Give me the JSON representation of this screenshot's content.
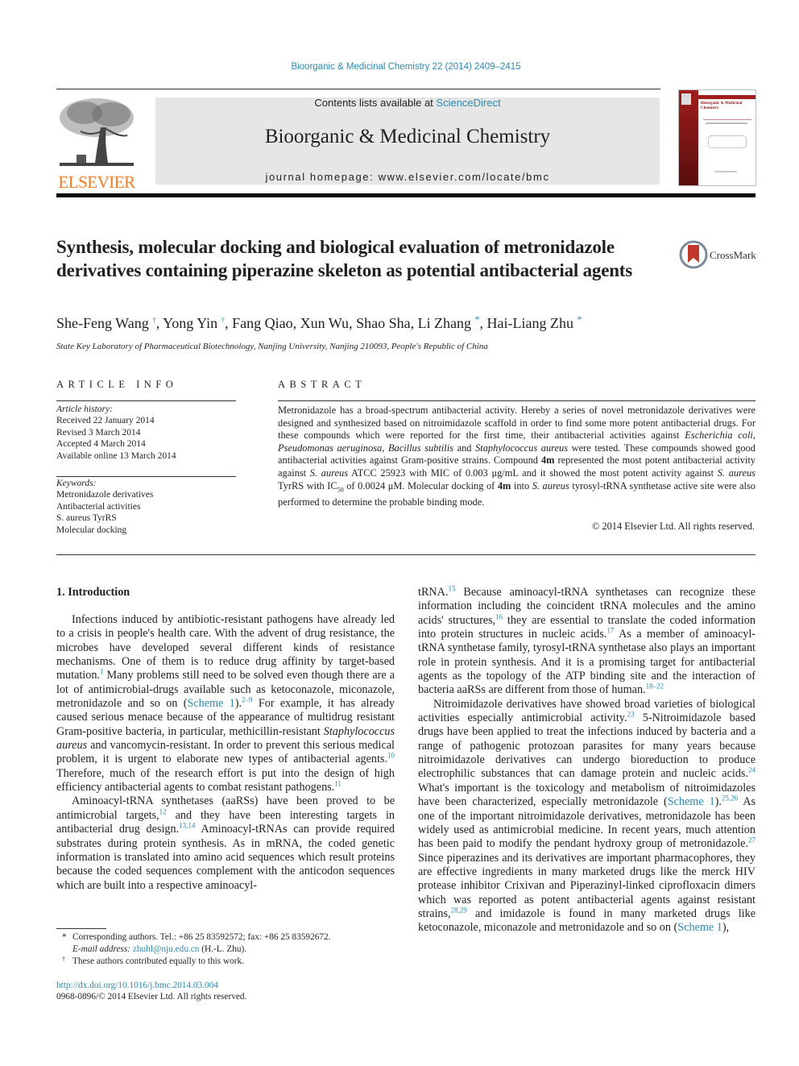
{
  "header": {
    "journal_reference": "Bioorganic & Medicinal Chemistry 22 (2014) 2409–2415",
    "contents_prefix": "Contents lists available at ",
    "contents_link": "ScienceDirect",
    "journal_title": "Bioorganic & Medicinal Chemistry",
    "homepage_label": "journal homepage: ",
    "homepage_url": "www.elsevier.com/locate/bmc",
    "publisher_logo_text": "ELSEVIER",
    "publisher_color": "#f47a20",
    "cover_title_line1": "Bioorganic & Medicinal",
    "cover_title_line2": "Chemistry",
    "cover_color": "#8b1a1a",
    "link_color": "#2a8bb5"
  },
  "article": {
    "title": "Synthesis, molecular docking and biological evaluation of metronidazole derivatives containing piperazine skeleton as potential antibacterial agents",
    "crossmark_label": "CrossMark",
    "authors": [
      {
        "name": "She-Feng Wang",
        "mark": "†"
      },
      {
        "name": "Yong Yin",
        "mark": "†"
      },
      {
        "name": "Fang Qiao",
        "mark": ""
      },
      {
        "name": "Xun Wu",
        "mark": ""
      },
      {
        "name": "Shao Sha",
        "mark": ""
      },
      {
        "name": "Li Zhang",
        "mark": "*"
      },
      {
        "name": "Hai-Liang Zhu",
        "mark": "*"
      }
    ],
    "affiliation": "State Key Laboratory of Pharmaceutical Biotechnology, Nanjing University, Nanjing 210093, People's Republic of China"
  },
  "article_info": {
    "label": "ARTICLE INFO",
    "history_label": "Article history:",
    "history": [
      "Received 22 January 2014",
      "Revised 3 March 2014",
      "Accepted 4 March 2014",
      "Available online 13 March 2014"
    ],
    "keywords_label": "Keywords:",
    "keywords": [
      "Metronidazole derivatives",
      "Antibacterial activities",
      "S. aureus TyrRS",
      "Molecular docking"
    ]
  },
  "abstract": {
    "label": "ABSTRACT",
    "s1": "Metronidazole has a broad-spectrum antibacterial activity. Hereby a series of novel metronidazole derivatives were designed and synthesized based on nitroimidazole scaffold in order to find some more potent antibacterial drugs. For these compounds which were reported for the first time, their antibacterial activities against ",
    "org1": "Escherichia coli",
    "sep1": ", ",
    "org2": "Pseudomonas aeruginosa",
    "sep2": ", ",
    "org3": "Bacillus subtilis",
    "sep3": " and ",
    "org4": "Staphylococcus aureus",
    "s2": " were tested. These compounds showed good antibacterial activities against Gram-positive strains. Compound ",
    "cmpd": "4m",
    "s3": " represented the most potent antibacterial activity against ",
    "org5": "S. aureus",
    "s4": " ATCC 25923 with MIC of 0.003 μg/mL and it showed the most potent activity against ",
    "org6": "S. aureus",
    "s5": " TyrRS with IC",
    "sub50": "50",
    "s6": " of 0.0024 μM. Molecular docking of ",
    "cmpd2": "4m",
    "s7": " into ",
    "org7": "S. aureus",
    "s8": " tyrosyl-tRNA synthetase active site were also performed to determine the probable binding mode.",
    "copyright": "© 2014 Elsevier Ltd. All rights reserved."
  },
  "body": {
    "section_heading": "1. Introduction",
    "p1": {
      "a": "Infections induced by antibiotic-resistant pathogens have already led to a crisis in people's health care. With the advent of drug resistance, the microbes have developed several different kinds of resistance mechanisms. One of them is to reduce drug affinity by target-based mutation.",
      "r1": "1",
      "b": " Many problems still need to be solved even though there are a lot of antimicrobial-drugs available such as ketoconazole, miconazole, metronidazole and so on (",
      "link1": "Scheme 1",
      "c": ").",
      "r2": "2–9",
      "d": " For example, it has already caused serious menace because of the appearance of multidrug resistant Gram-positive bacteria, in particular, methicillin-resistant ",
      "org": "Staphylococcus aureus",
      "e": " and vancomycin-resistant. In order to prevent this serious medical problem, it is urgent to elaborate new types of antibacterial agents.",
      "r3": "10",
      "f": " Therefore, much of the research effort is put into the design of high efficiency antibacterial agents to combat resistant pathogens.",
      "r4": "11"
    },
    "p2": {
      "a": "Aminoacyl-tRNA synthetases (aaRSs) have been proved to be antimicrobial targets,",
      "r1": "12",
      "b": " and they have been interesting targets in antibacterial drug design.",
      "r2": "13,14",
      "c": " Aminoacyl-tRNAs can provide required substrates during protein synthesis. As in mRNA, the coded genetic information is translated into amino acid sequences which result proteins because the coded sequences complement with the anticodon sequences which are built into a respective aminoacyl-"
    },
    "p2_cont": {
      "a": "tRNA.",
      "r1": "15",
      "b": " Because aminoacyl-tRNA synthetases can recognize these information including the coincident tRNA molecules and the amino acids' structures,",
      "r2": "16",
      "c": " they are essential to translate the coded information into protein structures in nucleic acids.",
      "r3": "17",
      "d": " As a member of aminoacyl-tRNA synthetase family, tyrosyl-tRNA synthetase also plays an important role in protein synthesis. And it is a promising target for antibacterial agents as the topology of the ATP binding site and the interaction of bacteria aaRSs are different from those of human.",
      "r4": "18–22"
    },
    "p3": {
      "a": "Nitroimidazole derivatives have showed broad varieties of biological activities especially antimicrobial activity.",
      "r1": "23",
      "b": " 5-Nitroimidazole based drugs have been applied to treat the infections induced by bacteria and a range of pathogenic protozoan parasites for many years because nitroimidazole derivatives can undergo bioreduction to produce electrophilic substances that can damage protein and nucleic acids.",
      "r2": "24",
      "c": " What's important is the toxicology and metabolism of nitroimidazoles have been characterized, especially metronidazole (",
      "link1": "Scheme 1",
      "d": ").",
      "r3": "25,26",
      "e": " As one of the important nitroimidazole derivatives, metronidazole has been widely used as antimicrobial medicine. In recent years, much attention has been paid to modify the pendant hydroxy group of metronidazole.",
      "r4": "27",
      "f": " Since piperazines and its derivatives are important pharmacophores, they are effective ingredients in many marketed drugs like the merck HIV protease inhibitor Crixivan and Piperazinyl-linked ciprofloxacin dimers which was reported as potent antibacterial agents against resistant strains,",
      "r5": "28,29",
      "g": " and imidazole is found in many marketed drugs like ketoconazole, miconazole and metronidazole and so on (",
      "link2": "Scheme 1",
      "h": "),"
    }
  },
  "footnotes": {
    "corr_mark": "*",
    "corr_text": "Corresponding authors. Tel.: +86 25 83592572; fax: +86 25 83592672.",
    "email_label": "E-mail address: ",
    "email": "zhuhl@nju.edu.cn",
    "email_suffix": " (H.-L. Zhu).",
    "equal_mark": "†",
    "equal_text": "These authors contributed equally to this work.",
    "doi": "http://dx.doi.org/10.1016/j.bmc.2014.03.004",
    "issn": "0968-0896/© 2014 Elsevier Ltd. All rights reserved."
  }
}
